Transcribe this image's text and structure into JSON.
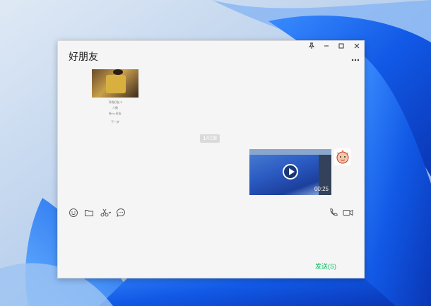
{
  "window": {
    "title": "好朋友",
    "controls": {
      "pin_icon": "pin-icon",
      "minimize_icon": "minimize-icon",
      "maximize_icon": "maximize-icon",
      "close_icon": "close-icon",
      "more_icon": "more-icon"
    }
  },
  "messages": {
    "image_message": {
      "caption_lines": [
        "寻找好友 5",
        "人数",
        "新 to 好友",
        "下一步"
      ]
    },
    "timestamp": "14:08",
    "video_message": {
      "duration": "00:25"
    }
  },
  "toolbar": {
    "left_icons": [
      "emoji-icon",
      "folder-icon",
      "scissors-icon",
      "chat-bubble-icon"
    ],
    "right_icons": [
      "phone-icon",
      "video-camera-icon"
    ]
  },
  "composer": {
    "send_label": "发送(S)"
  },
  "colors": {
    "send_green": "#07c160",
    "window_bg": "#f5f5f5",
    "timestamp_bg": "#dadada"
  }
}
